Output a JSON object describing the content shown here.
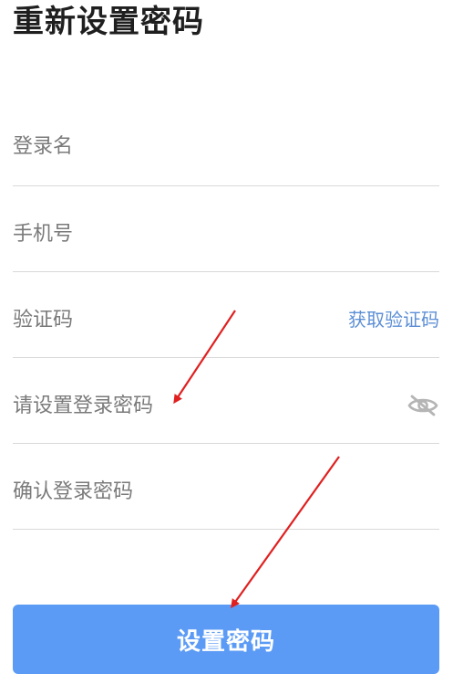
{
  "page": {
    "title": "重新设置密码"
  },
  "form": {
    "username": {
      "placeholder": "登录名",
      "value": ""
    },
    "phone": {
      "placeholder": "手机号",
      "value": ""
    },
    "code": {
      "placeholder": "验证码",
      "value": "",
      "action_label": "获取验证码"
    },
    "password": {
      "placeholder": "请设置登录密码",
      "value": "",
      "toggle_icon": "eye-off-icon"
    },
    "confirm": {
      "placeholder": "确认登录密码",
      "value": ""
    }
  },
  "submit": {
    "label": "设置密码"
  },
  "colors": {
    "accent": "#5b9bf5",
    "link": "#5d8fd6",
    "annotation_arrow": "#e02020"
  }
}
